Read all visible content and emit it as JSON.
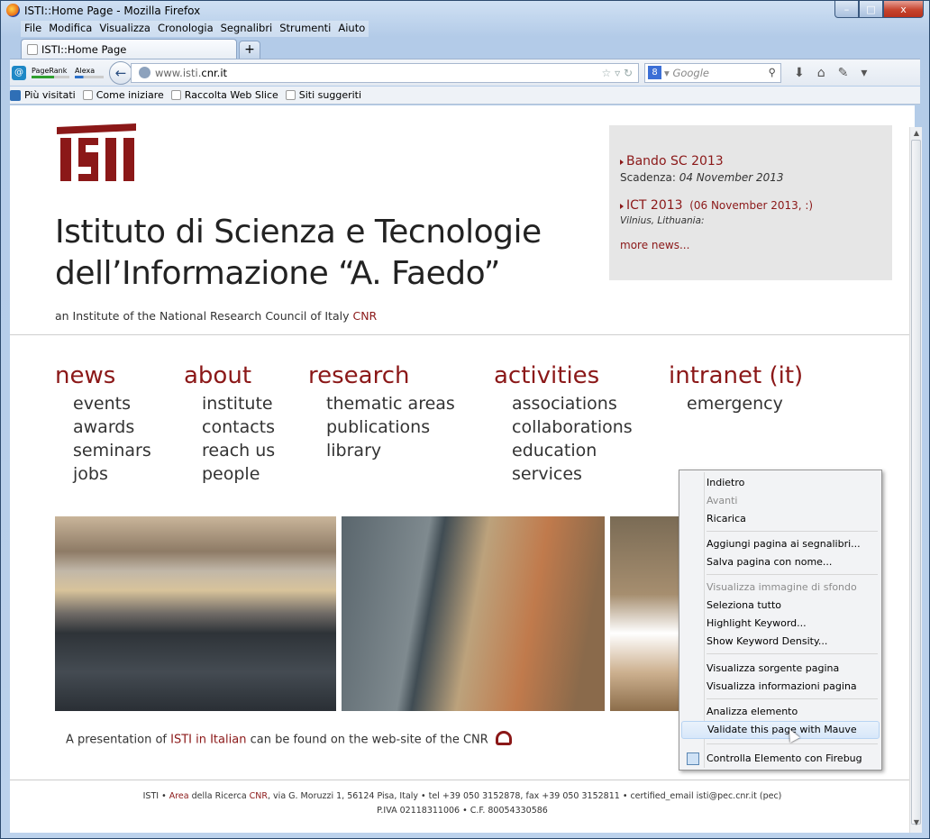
{
  "window": {
    "title": "ISTI::Home Page - Mozilla Firefox",
    "controls": [
      "–",
      "□",
      "x"
    ]
  },
  "menu": [
    "File",
    "Modifica",
    "Visualizza",
    "Cronologia",
    "Segnalibri",
    "Strumenti",
    "Aiuto"
  ],
  "tab": {
    "label": "ISTI::Home Page",
    "new_tab": "+"
  },
  "toolbar": {
    "pagerank": "PageRank",
    "alexa": "Alexa",
    "url_prefix": "www.isti.",
    "url_host": "cnr.it",
    "search_placeholder": "Google",
    "search_engine": "8"
  },
  "bookmarks": [
    "Più visitati",
    "Come iniziare",
    "Raccolta Web Slice",
    "Siti suggeriti"
  ],
  "site": {
    "title_line1": "Istituto di Scienza e Tecnologie",
    "title_line2": "dell’Informazione “A. Faedo”",
    "subtitle": "an Institute of the National Research Council of Italy",
    "subtitle_link": "CNR",
    "news": [
      {
        "title": "Bando SC 2013",
        "detail_prefix": "Scadenza: ",
        "detail": "04 November 2013"
      },
      {
        "title": "ICT 2013",
        "date": "(06 November 2013, :)",
        "detail": "Vilnius, Lithuania:"
      }
    ],
    "more_news": "more news...",
    "nav": [
      {
        "heading": "news",
        "items": [
          "events",
          "awards",
          "seminars",
          "jobs"
        ]
      },
      {
        "heading": "about",
        "items": [
          "institute",
          "contacts",
          "reach us",
          "people"
        ]
      },
      {
        "heading": "research",
        "items": [
          "thematic areas",
          "publications",
          "library"
        ]
      },
      {
        "heading": "activities",
        "items": [
          "associations",
          "collaborations",
          "education",
          "services"
        ]
      },
      {
        "heading": "intranet (it)",
        "items": [
          "emergency"
        ]
      }
    ],
    "presentation_a": "A presentation of",
    "presentation_link": "ISTI in Italian",
    "presentation_b": "can be found on the web-site of the CNR",
    "footer_1a": "ISTI • ",
    "footer_area": "Area",
    "footer_1b": " della Ricerca ",
    "footer_cnr": "CNR",
    "footer_1c": ", via G. Moruzzi 1, 56124 Pisa, Italy • tel +39 050 3152878, fax +39 050 3152811 • certified_email isti@pec.cnr.it (pec)",
    "footer_2": "P.IVA 02118311006 • C.F. 80054330586"
  },
  "context_menu": [
    {
      "label": "Indietro",
      "state": "enabled"
    },
    {
      "label": "Avanti",
      "state": "disabled"
    },
    {
      "label": "Ricarica",
      "state": "enabled"
    },
    {
      "label": "Aggiungi pagina ai segnalibri...",
      "state": "enabled"
    },
    {
      "label": "Salva pagina con nome...",
      "state": "enabled"
    },
    {
      "label": "Visualizza immagine di sfondo",
      "state": "disabled"
    },
    {
      "label": "Seleziona tutto",
      "state": "enabled"
    },
    {
      "label": "Highlight Keyword...",
      "state": "enabled"
    },
    {
      "label": "Show Keyword Density...",
      "state": "enabled"
    },
    {
      "label": "Visualizza sorgente pagina",
      "state": "enabled"
    },
    {
      "label": "Visualizza informazioni pagina",
      "state": "enabled"
    },
    {
      "label": "Analizza elemento",
      "state": "enabled"
    },
    {
      "label": "Validate this page with Mauve",
      "state": "highlighted"
    },
    {
      "label": "Controlla Elemento con Firebug",
      "state": "enabled"
    }
  ],
  "colors": {
    "accent": "#8b1818",
    "news_box": "#e6e6e6"
  }
}
